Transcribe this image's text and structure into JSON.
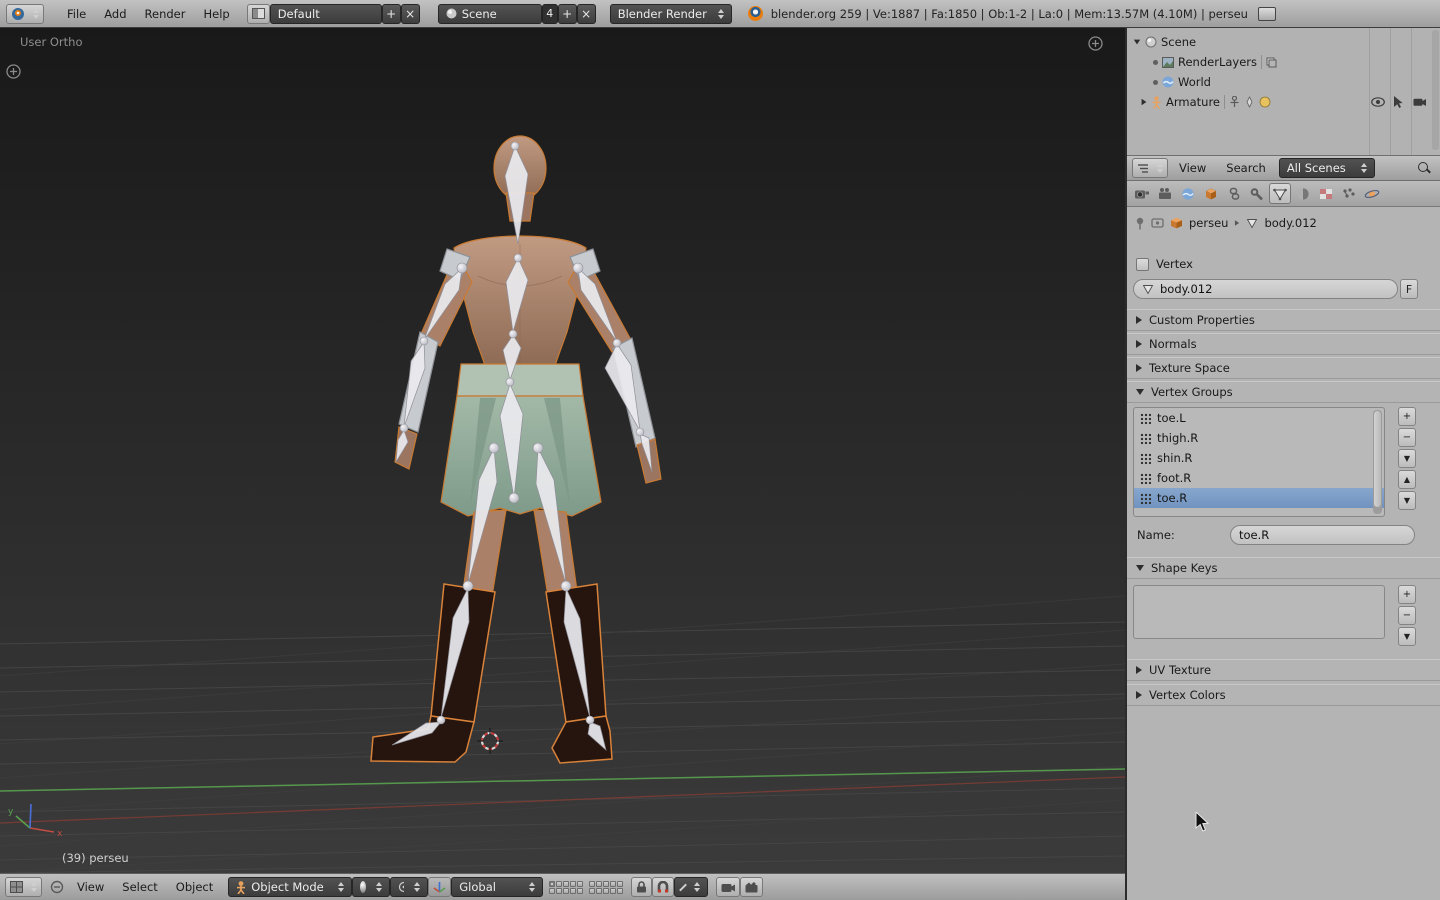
{
  "colors": {
    "selection_blue": "#7b9cc9",
    "armature_orange": "#d8823a",
    "header_gray": "#b0b0b0"
  },
  "glyphs": {
    "plus": "+",
    "minus": "−",
    "close": "×",
    "filter_down": "▼",
    "move_up": "▲",
    "move_down": "▼"
  },
  "topbar": {
    "menus": [
      "File",
      "Add",
      "Render",
      "Help"
    ],
    "layout_value": "Default",
    "scene_value": "Scene",
    "scene_count": "4",
    "engine_value": "Blender Render",
    "stats": "blender.org 259 | Ve:1887 | Fa:1850 | Ob:1-2 | La:0 | Mem:13.57M (4.10M) | perseu"
  },
  "viewport": {
    "view_label": "User Ortho",
    "object_info": "(39) perseu"
  },
  "vp_header": {
    "menus": [
      "View",
      "Select",
      "Object"
    ],
    "mode_value": "Object Mode",
    "orientation_value": "Global"
  },
  "outliner": {
    "rows": [
      "Scene",
      "RenderLayers",
      "World",
      "Armature"
    ],
    "menus": [
      "View",
      "Search"
    ],
    "scenes_value": "All Scenes"
  },
  "properties": {
    "breadcrumb": {
      "object": "perseu",
      "data": "body.012"
    },
    "vertex_label": "Vertex",
    "name_value": "body.012",
    "fake_user_label": "F",
    "panels": {
      "custom_properties": "Custom Properties",
      "normals": "Normals",
      "texture_space": "Texture Space",
      "vertex_groups": "Vertex Groups",
      "shape_keys": "Shape Keys",
      "uv_texture": "UV Texture",
      "vertex_colors": "Vertex Colors"
    },
    "vertex_groups": {
      "items": [
        "toe.L",
        "thigh.R",
        "shin.R",
        "foot.R",
        "toe.R"
      ],
      "name_label": "Name:",
      "name_value": "toe.R"
    }
  }
}
